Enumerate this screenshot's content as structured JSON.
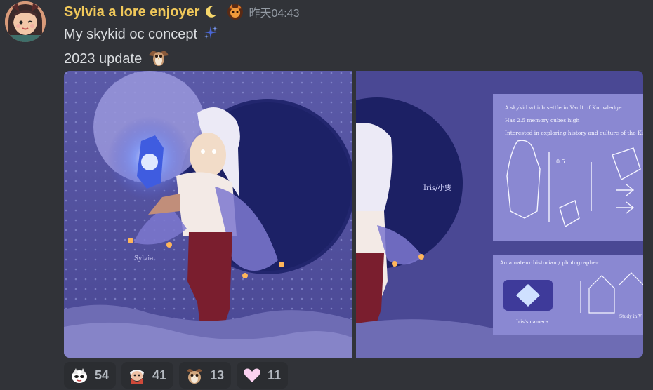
{
  "message": {
    "author": "Sylvia a lore enjoyer",
    "timestamp": "昨天04:43",
    "lines": [
      "My skykid oc concept",
      "2023 update"
    ]
  },
  "attachments": [
    {
      "icon": "artwork-image",
      "handwriting": "Iris/小雯",
      "signature": "Sylvia"
    },
    {
      "icon": "concept-sheet-image",
      "handwriting": "Iris/小雯",
      "notes": [
        "A skykid which settle in Vault of Knowledge",
        "Has 2.5 memory cubes high",
        "Interested in exploring history and culture of the Kingdom"
      ],
      "sketch_label": "0.5",
      "section_title": "An amateur historian / photographer",
      "camera_label": "Iris's camera",
      "study_label": "Study in V"
    }
  ],
  "reactions": [
    {
      "icon": "mask-emoji",
      "count": "54"
    },
    {
      "icon": "sky-child-emoji",
      "count": "41"
    },
    {
      "icon": "owl-emoji",
      "count": "13"
    },
    {
      "icon": "pink-heart-emoji",
      "count": "11"
    }
  ],
  "colors": {
    "username": "#f0c85a",
    "background": "#313338",
    "reaction_bg": "#2b2d31",
    "timestamp": "#949ba4"
  }
}
